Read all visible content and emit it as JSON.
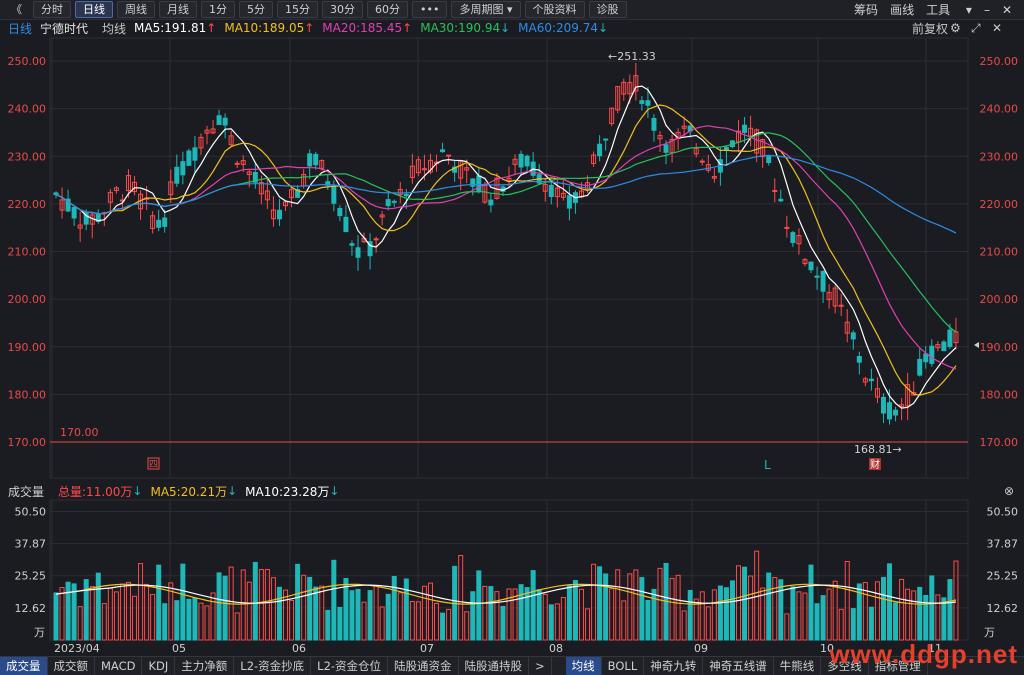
{
  "toolbar": {
    "back": "《",
    "periods": [
      "分时",
      "日线",
      "周线",
      "月线",
      "1分",
      "5分",
      "15分",
      "30分",
      "60分"
    ],
    "active": "日线",
    "more": "•••",
    "multi": "多周期图",
    "info": "个股资料",
    "diag": "诊股",
    "right": [
      "筹码",
      "画线",
      "工具"
    ]
  },
  "legend": {
    "period": "日线",
    "name": "宁德时代",
    "ma_label": "均线",
    "ma5": "MA5:191.81",
    "ma10": "MA10:189.05",
    "ma20": "MA20:185.45",
    "ma30": "MA30:190.94",
    "ma60": "MA60:209.74",
    "adjust": "前复权"
  },
  "colors": {
    "up": "#ff4a4a",
    "down": "#1fb7b7",
    "ma5": "#ffffff",
    "ma10": "#f0c020",
    "ma20": "#e040b0",
    "ma30": "#27c05a",
    "ma60": "#2f8be6",
    "bg": "#1b1c21",
    "grid": "#2c2d34"
  },
  "price_axis": {
    "ticks": [
      "250.00",
      "240.00",
      "230.00",
      "220.00",
      "210.00",
      "200.00",
      "190.00",
      "180.00",
      "170.00"
    ]
  },
  "annotations": {
    "high": "251.33",
    "low": "168.81",
    "hline": "170.00",
    "markers": [
      "四",
      "L",
      "财"
    ]
  },
  "volume_legend": {
    "label": "成交量",
    "total": "总量:11.00万",
    "ma5": "MA5:20.21万",
    "ma10": "MA10:23.28万"
  },
  "volume_axis": {
    "ticks": [
      "50.50",
      "37.87",
      "25.25",
      "12.62"
    ],
    "unit": "万"
  },
  "months": [
    "2023/04",
    "05",
    "06",
    "07",
    "08",
    "09",
    "10",
    "11"
  ],
  "bottom_tabs": [
    "成交量",
    "成交额",
    "MACD",
    "KDJ",
    "主力净额",
    "L2-资金抄底",
    "L2-资金仓位",
    "陆股通资金",
    "陆股通持股",
    ">",
    "均线",
    "BOLL",
    "神奇九转",
    "神奇五线谱",
    "牛熊线",
    "多空线",
    "指标管理"
  ],
  "bottom_active": [
    "成交量",
    "均线"
  ],
  "watermark": "www.ddgp.net",
  "chart_data": {
    "type": "candlestick",
    "title": "宁德时代 日线",
    "ylim": [
      165,
      255
    ],
    "volume_ylim": [
      0,
      55
    ],
    "candles_ohlc": [],
    "approx_close_path": [
      222,
      219,
      216,
      218,
      222,
      224,
      219,
      215,
      226,
      230,
      236,
      239,
      231,
      226,
      221,
      217,
      222,
      230,
      226,
      219,
      210,
      211,
      218,
      222,
      227,
      229,
      231,
      227,
      224,
      222,
      225,
      229,
      227,
      224,
      219,
      222,
      229,
      239,
      246,
      244,
      236,
      232,
      235,
      231,
      227,
      233,
      236,
      232,
      224,
      214,
      209,
      204,
      200,
      192,
      184,
      178,
      176,
      181,
      188,
      190,
      192
    ],
    "ma_last": {
      "MA5": 191.81,
      "MA10": 189.05,
      "MA20": 185.45,
      "MA30": 190.94,
      "MA60": 209.74
    }
  }
}
